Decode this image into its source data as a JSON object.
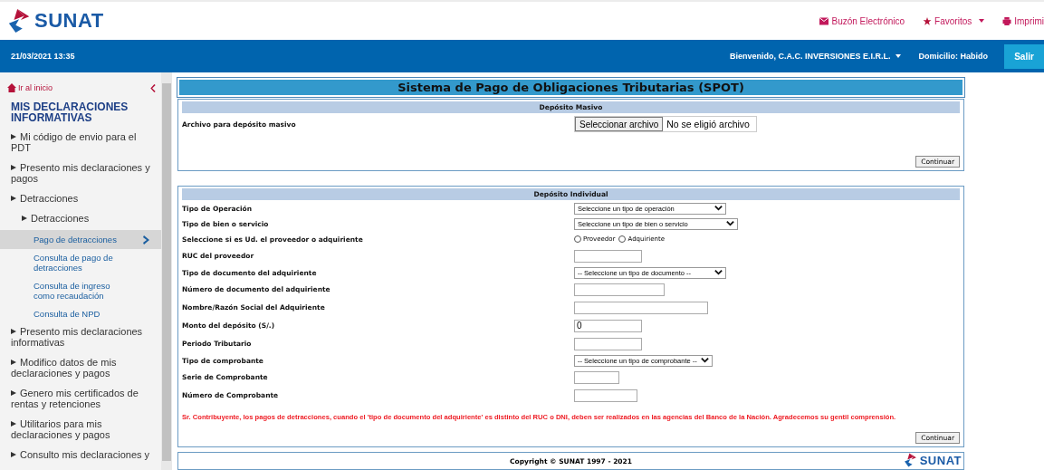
{
  "header": {
    "logo": "SUNAT",
    "links": [
      {
        "kind": "mail",
        "label": "Buzón Electrónico",
        "dropdown": false
      },
      {
        "kind": "star",
        "label": "Favoritos",
        "dropdown": true
      },
      {
        "kind": "print",
        "label": "Imprimi",
        "dropdown": false
      }
    ]
  },
  "top_bar": {
    "datetime": "21/03/2021 13:35",
    "welcome": "Bienvenido, C.A.C. INVERSIONES E.I.R.L.",
    "domicilio": "Domicilio: Habido",
    "exit_button": "Salir"
  },
  "sidebar": {
    "home_link": "Ir al inicio",
    "heading": "MIS DECLARACIONES INFORMATIVAS",
    "items": [
      {
        "label": "Mi código de envio para el PDT",
        "selected": false
      },
      {
        "label": "Presento mis declaraciones y pagos",
        "selected": false
      },
      {
        "label": "Detracciones",
        "selected": false,
        "children": [
          {
            "label": "Detracciones",
            "selected": false,
            "children": [
              {
                "label": "Pago de detracciones",
                "selected": true
              },
              {
                "label": "Consulta de pago de detracciones",
                "selected": false
              },
              {
                "label": "Consulta de ingreso como recaudación",
                "selected": false
              },
              {
                "label": "Consulta de NPD",
                "selected": false
              }
            ]
          }
        ]
      },
      {
        "label": "Presento mis declaraciones informativas",
        "selected": false
      },
      {
        "label": "Modifico datos de mis declaraciones y pagos",
        "selected": false
      },
      {
        "label": "Genero mis certificados de rentas y retenciones",
        "selected": false
      },
      {
        "label": "Utilitarios para mis declaraciones y pagos",
        "selected": false
      },
      {
        "label": "Consulto mis declaraciones y",
        "selected": false
      }
    ]
  },
  "title": "Sistema de Pago de Obligaciones Tributarias (SPOT)",
  "deposito_masivo": {
    "heading": "Depósito Masivo",
    "label": "Archivo para depósito masivo",
    "file_button": "Seleccionar archivo",
    "file_status": "No se eligió archivo",
    "submit": "Continuar"
  },
  "deposito_individual": {
    "heading": "Depósito Individual",
    "fields": [
      {
        "label": "Tipo de Operación",
        "kind": "select",
        "value": "Seleccione un tipo de operación"
      },
      {
        "label": "Tipo de bien o servicio",
        "kind": "select",
        "value": "Seleccione un tipo de bien o servicio"
      },
      {
        "label": "Seleccione si es Ud. el proveedor o adquiriente",
        "kind": "radio",
        "options": [
          {
            "label": "Proveedor",
            "selected": false
          },
          {
            "label": "Adquiriente",
            "selected": false
          }
        ]
      },
      {
        "label": "RUC del proveedor",
        "kind": "input"
      },
      {
        "label": "Tipo de documento del adquiriente",
        "kind": "select",
        "value": "-- Seleccione un tipo de documento --"
      },
      {
        "label": "Número de documento del adquiriente",
        "kind": "input"
      },
      {
        "label": "Nombre/Razón Social del Adquiriente",
        "kind": "input"
      },
      {
        "label": "Monto del depósito (S/.)",
        "kind": "input",
        "value": "0"
      },
      {
        "label": "Periodo Tributario",
        "kind": "input"
      },
      {
        "label": "Tipo de comprobante",
        "kind": "select",
        "value": "-- Seleccione un tipo de comprobante --"
      },
      {
        "label": "Serie de Comprobante",
        "kind": "input"
      },
      {
        "label": "Número de Comprobante",
        "kind": "input"
      }
    ],
    "note": "Sr. Contribuyente, los pagos de detracciones, cuando el 'tipo de documento del adquiriente' es distinto del RUC o DNI, deben ser realizados en las agencias del Banco de la Nación. Agradecemos su gentil comprensión.",
    "submit": "Continuar"
  },
  "footer": {
    "copyright": "Copyright © SUNAT 1997 - 2021",
    "logo": "SUNAT"
  }
}
